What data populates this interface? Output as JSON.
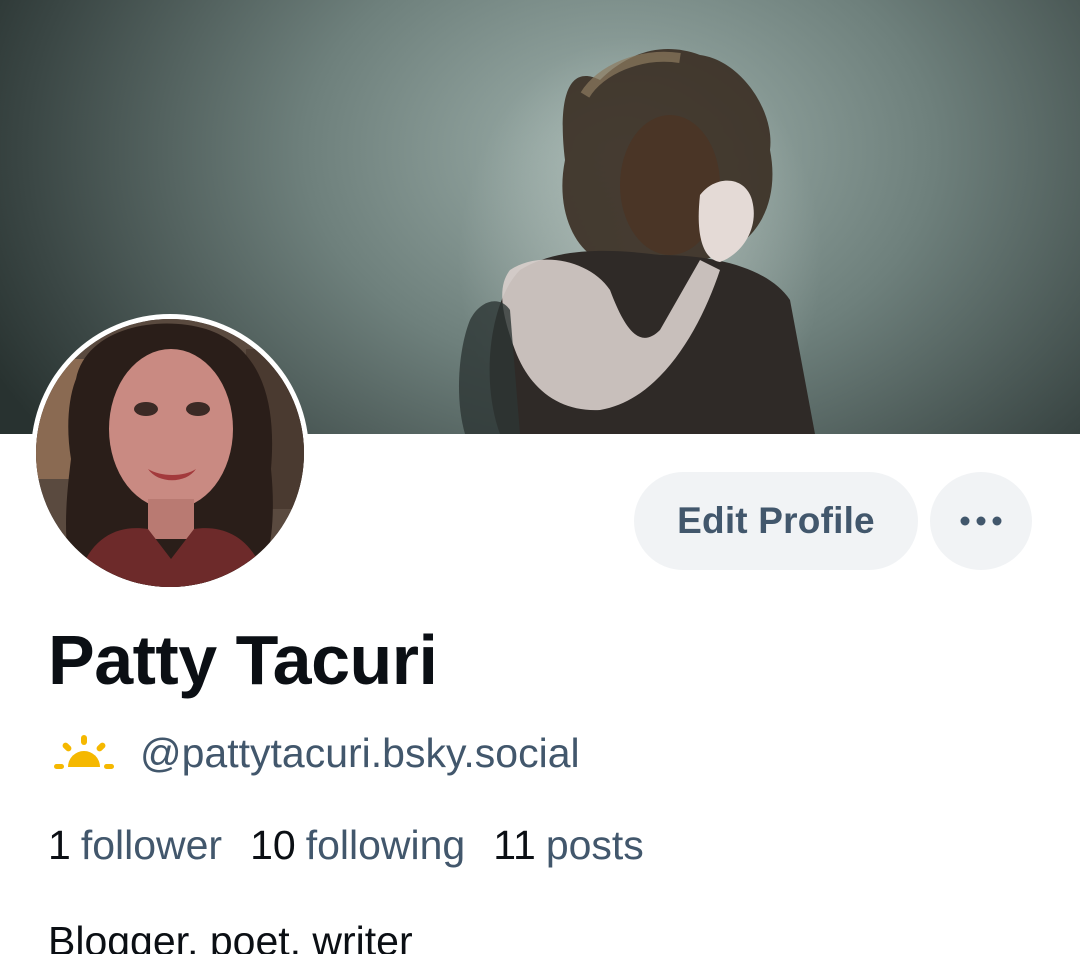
{
  "profile": {
    "display_name": "Patty Tacuri",
    "handle": "@pattytacuri.bsky.social",
    "handle_icon": "sunrise-icon",
    "bio": "Blogger, poet, writer",
    "stats": [
      {
        "count": "1",
        "label": "follower"
      },
      {
        "count": "10",
        "label": "following"
      },
      {
        "count": "11",
        "label": "posts"
      }
    ]
  },
  "actions": {
    "edit_label": "Edit Profile",
    "more_icon": "more-options-icon"
  },
  "colors": {
    "text_primary": "#0b0f14",
    "text_secondary": "#42576c",
    "button_bg": "#f1f3f5",
    "sun_icon": "#f5b800"
  }
}
